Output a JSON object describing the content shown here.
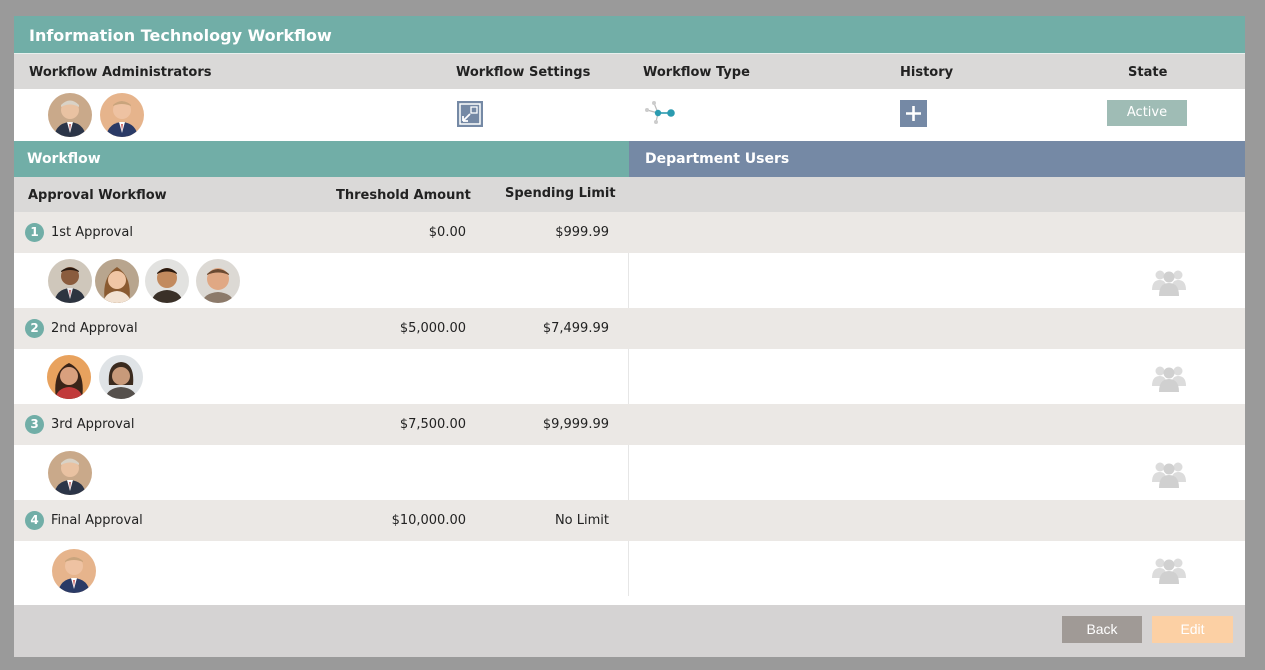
{
  "window": {
    "title": "Information Technology Workflow"
  },
  "header": {
    "administrators_label": "Workflow Administrators",
    "settings_label": "Workflow Settings",
    "type_label": "Workflow Type",
    "history_label": "History",
    "state_label": "State",
    "state_value": "Active"
  },
  "workflow": {
    "section_title": "Workflow",
    "columns": {
      "approval": "Approval Workflow",
      "threshold": "Threshold Amount",
      "limit": "Spending Limit"
    },
    "steps": [
      {
        "number": "1",
        "name": "1st Approval",
        "threshold": "$0.00",
        "limit": "$999.99"
      },
      {
        "number": "2",
        "name": "2nd Approval",
        "threshold": "$5,000.00",
        "limit": "$7,499.99"
      },
      {
        "number": "3",
        "name": "3rd Approval",
        "threshold": "$7,500.00",
        "limit": "$9,999.99"
      },
      {
        "number": "4",
        "name": "Final Approval",
        "threshold": "$10,000.00",
        "limit": "No Limit"
      }
    ]
  },
  "department_users": {
    "section_title": "Department Users"
  },
  "footer": {
    "back_label": "Back",
    "edit_label": "Edit"
  },
  "colors": {
    "teal": "#71aea7",
    "slate": "#7589a5",
    "edit": "#fcd0a4",
    "back": "#a09a96"
  },
  "icons": {
    "settings": "expand-icon",
    "type": "network-icon",
    "history": "plus-icon",
    "users": "group-icon"
  }
}
